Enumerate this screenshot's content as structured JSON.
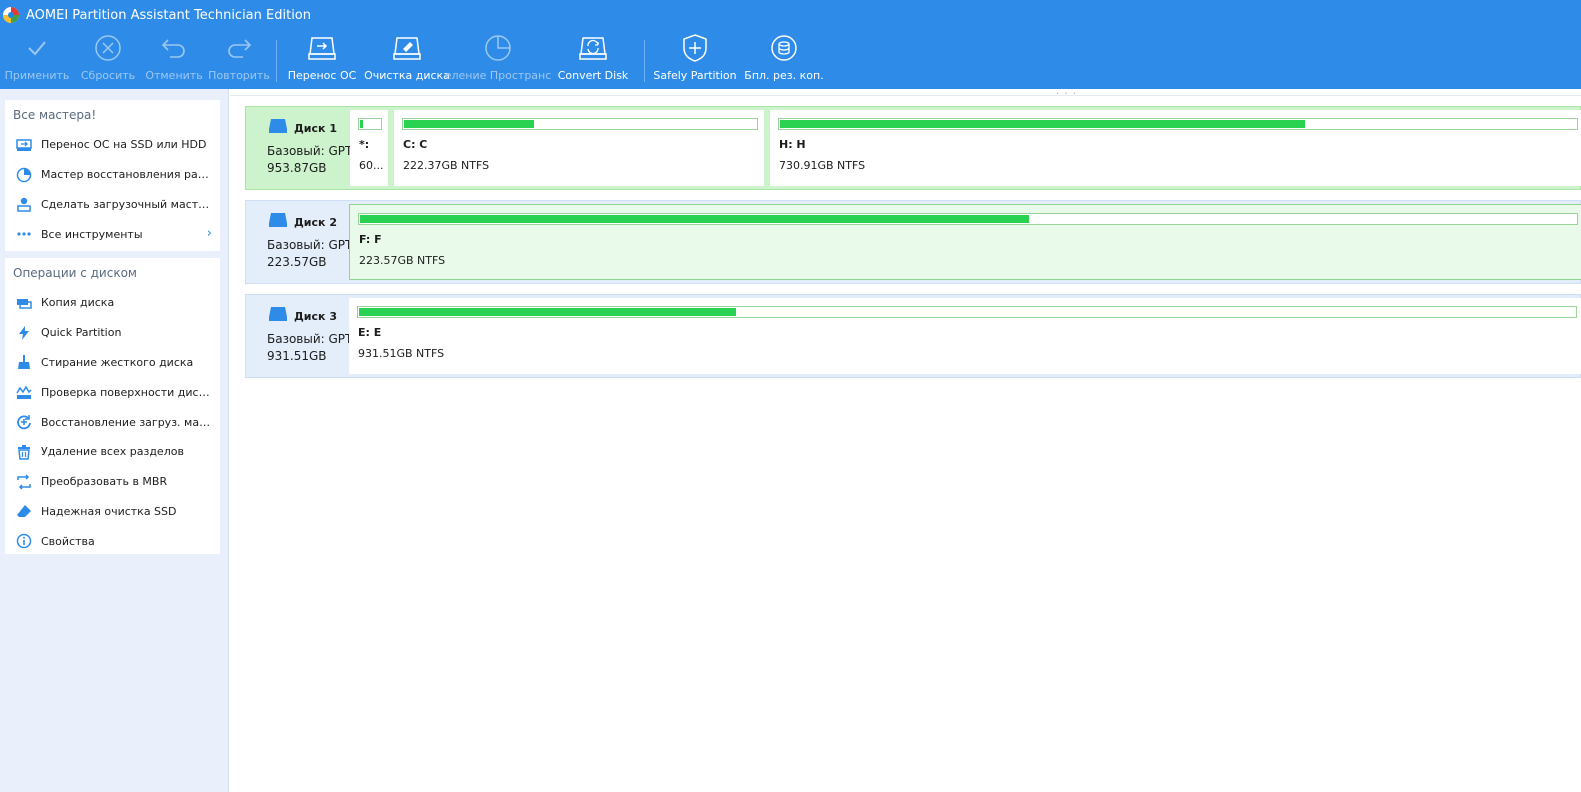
{
  "window": {
    "title": "AOMEI Partition Assistant Technician Edition"
  },
  "toolbar": {
    "apply": "Применить",
    "discard": "Сбросить",
    "undo": "Отменить",
    "redo": "Повторить",
    "migrate_os": "Перенос ОС",
    "wipe_disk": "Очистка диска",
    "allocate_space": "еление Пространс",
    "convert_disk": "Convert Disk",
    "safely_partition": "Safely Partition",
    "backup": "Бпл. рез. коп."
  },
  "sidebar": {
    "wizards": {
      "title": "Все мастера!",
      "items": [
        {
          "label": "Перенос ОС на SSD или HDD",
          "icon": "migrate-os-icon"
        },
        {
          "label": "Мастер восстановления раздела",
          "icon": "partition-recovery-icon"
        },
        {
          "label": "Сделать загрузочный мастер-...",
          "icon": "bootable-media-icon"
        },
        {
          "label": "Все инструменты",
          "icon": "more-dots-icon"
        }
      ]
    },
    "disk_ops": {
      "title": "Операции с диском",
      "items": [
        {
          "label": "Копия диска",
          "icon": "disk-copy-icon"
        },
        {
          "label": "Quick Partition",
          "icon": "lightning-icon"
        },
        {
          "label": "Стирание жесткого диска",
          "icon": "broom-icon"
        },
        {
          "label": "Проверка поверхности диска",
          "icon": "surface-test-icon"
        },
        {
          "label": "Восстановление загруз. масте...",
          "icon": "rebuild-mbr-icon"
        },
        {
          "label": "Удаление всех разделов",
          "icon": "trash-icon"
        },
        {
          "label": "Преобразовать в MBR",
          "icon": "convert-icon"
        },
        {
          "label": "Надежная очистка SSD",
          "icon": "eraser-icon"
        },
        {
          "label": "Свойства",
          "icon": "info-icon"
        }
      ]
    }
  },
  "disks": [
    {
      "name": "Диск 1",
      "type": "Базовый: GPT",
      "size": "953.87GB",
      "selected": true,
      "partitions": [
        {
          "label": "*:",
          "info": "60...",
          "used_fraction": 0.15
        },
        {
          "label": "C: C",
          "info": "222.37GB NTFS",
          "used_fraction": 0.37
        },
        {
          "label": "H: H",
          "info": "730.91GB NTFS",
          "used_fraction": 0.66
        }
      ]
    },
    {
      "name": "Диск 2",
      "type": "Базовый: GPT",
      "size": "223.57GB",
      "selected": false,
      "partitions": [
        {
          "label": "F: F",
          "info": "223.57GB NTFS",
          "used_fraction": 0.55,
          "selected": true
        }
      ]
    },
    {
      "name": "Диск 3",
      "type": "Базовый: GPT",
      "size": "931.51GB",
      "selected": false,
      "partitions": [
        {
          "label": "E: E",
          "info": "931.51GB NTFS",
          "used_fraction": 0.31
        }
      ]
    }
  ],
  "colors": {
    "accent": "#2e8ce8",
    "usage_fill": "#2bd150",
    "selected_row": "#cdf3cd",
    "sidebar_bg": "#e9f0fb"
  }
}
